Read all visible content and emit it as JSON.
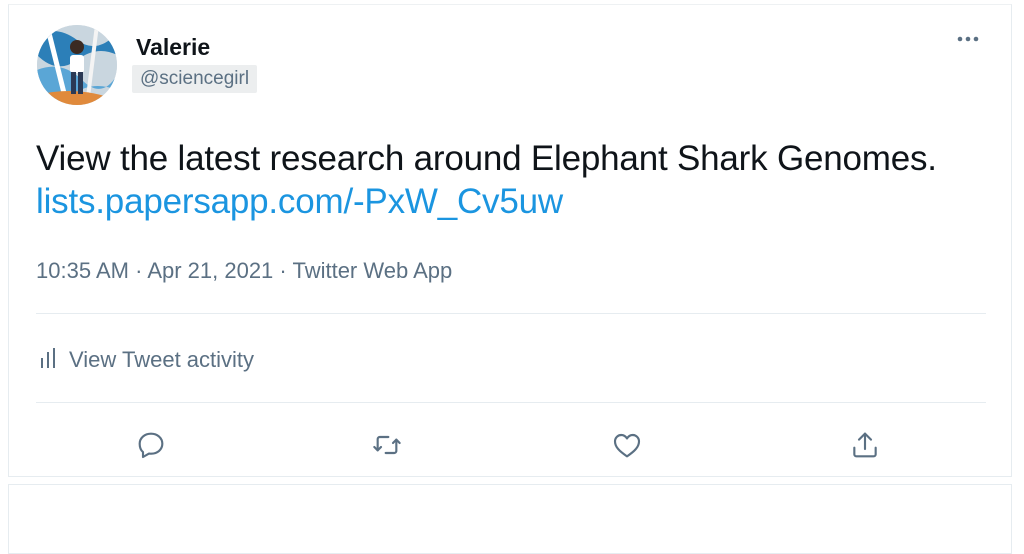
{
  "tweet": {
    "author_name": "Valerie",
    "author_handle": "@sciencegirl",
    "text": "View the latest research around Elephant Shark Genomes.",
    "link_text": "lists.papersapp.com/-PxW_Cv5uw",
    "time": "10:35 AM",
    "separator": "·",
    "date": "Apr 21, 2021",
    "source": "Twitter Web App"
  },
  "activity": {
    "label": "View Tweet activity",
    "icon": "bar-chart-icon"
  },
  "actions": [
    {
      "name": "reply",
      "icon": "reply-icon"
    },
    {
      "name": "retweet",
      "icon": "retweet-icon"
    },
    {
      "name": "like",
      "icon": "heart-icon"
    },
    {
      "name": "share",
      "icon": "share-icon"
    }
  ],
  "colors": {
    "link": "#1b95e0",
    "secondary_text": "#5b7083",
    "divider": "#e6ecf0"
  }
}
